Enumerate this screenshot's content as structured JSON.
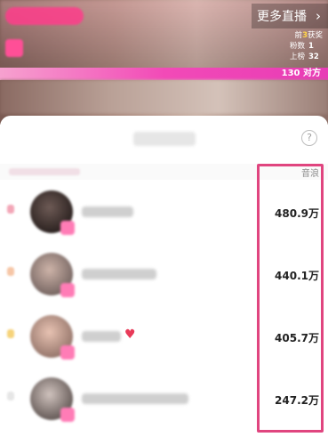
{
  "live_header": {
    "more_live_label": "更多直播",
    "chevron": "chevron-right-icon",
    "rank_prefix": "前",
    "rank_number": "3",
    "rank_suffix": "获奖",
    "stat1_label": "粉数",
    "stat1_value": "1",
    "stat2_label": "上榜",
    "stat2_value": "32",
    "bar_text": "130 对方"
  },
  "panel": {
    "help_icon": "question-circle-icon",
    "column_header": "音浪"
  },
  "rows": [
    {
      "score": "480.9万"
    },
    {
      "score": "440.1万"
    },
    {
      "score": "405.7万",
      "heart": "♥"
    },
    {
      "score": "247.2万"
    }
  ],
  "colors": {
    "accent_pink": "#e0457f",
    "bar_pink": "#f24ab7",
    "heart_red": "#e83a58"
  }
}
